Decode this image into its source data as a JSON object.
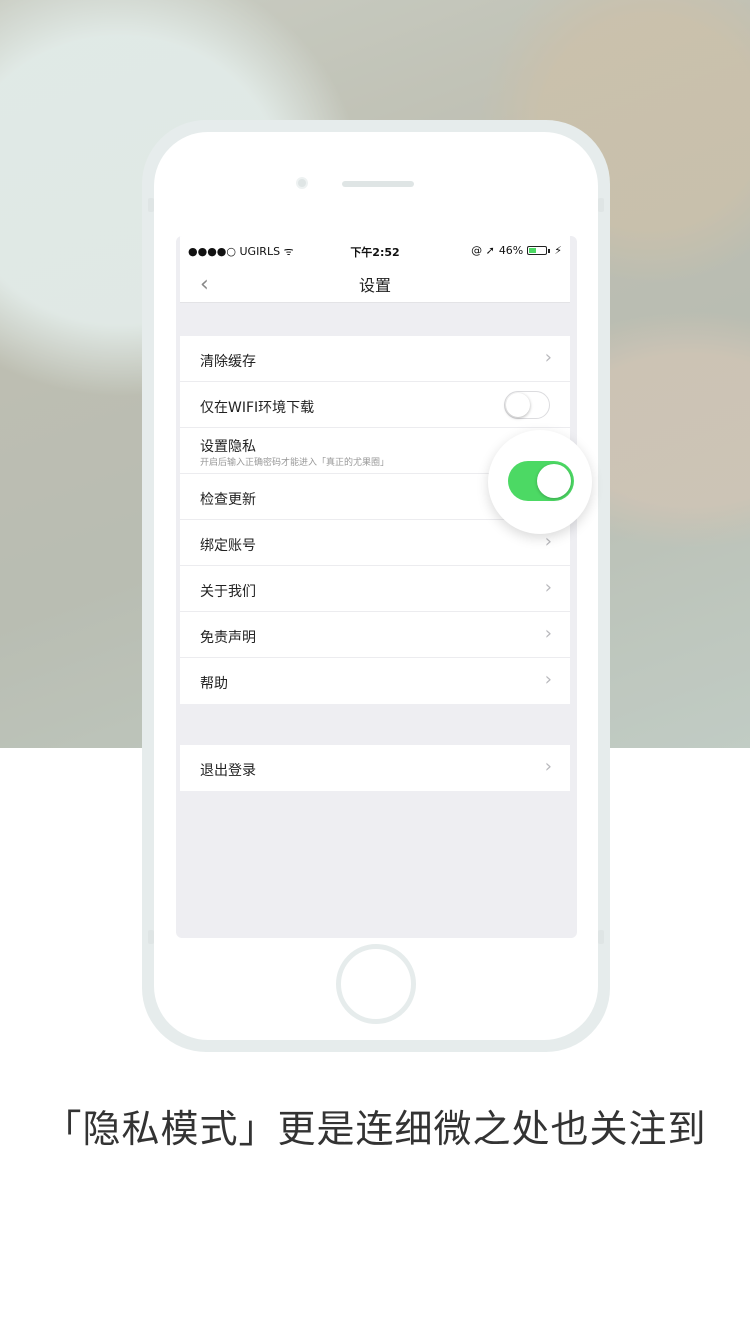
{
  "status_bar": {
    "carrier": "●●●●○ UGIRLS",
    "wifi_icon": "wifi-icon",
    "time": "下午2:52",
    "location_icons": "@ ➚",
    "battery_percent": "46%",
    "battery_level": 0.46
  },
  "nav": {
    "back_icon": "chevron-left-icon",
    "back_glyph": "‹",
    "title": "设置"
  },
  "settings": {
    "items": [
      {
        "label": "清除缓存",
        "chevron": "›"
      },
      {
        "label": "仅在WIFI环境下载",
        "toggle": "off"
      },
      {
        "label": "设置隐私",
        "subtitle": "开启后输入正确密码才能进入「真正的尤果圈」",
        "toggle": "on"
      },
      {
        "label": "检查更新"
      },
      {
        "label": "绑定账号",
        "chevron": "›"
      },
      {
        "label": "关于我们",
        "chevron": "›"
      },
      {
        "label": "免责声明",
        "chevron": "›"
      },
      {
        "label": "帮助",
        "chevron": "›"
      }
    ]
  },
  "logout": {
    "label": "退出登录",
    "chevron": "›"
  },
  "caption": "「隐私模式」更是连细微之处也关注到",
  "colors": {
    "toggle_on": "#4cd964",
    "screen_bg": "#eeeef2"
  }
}
